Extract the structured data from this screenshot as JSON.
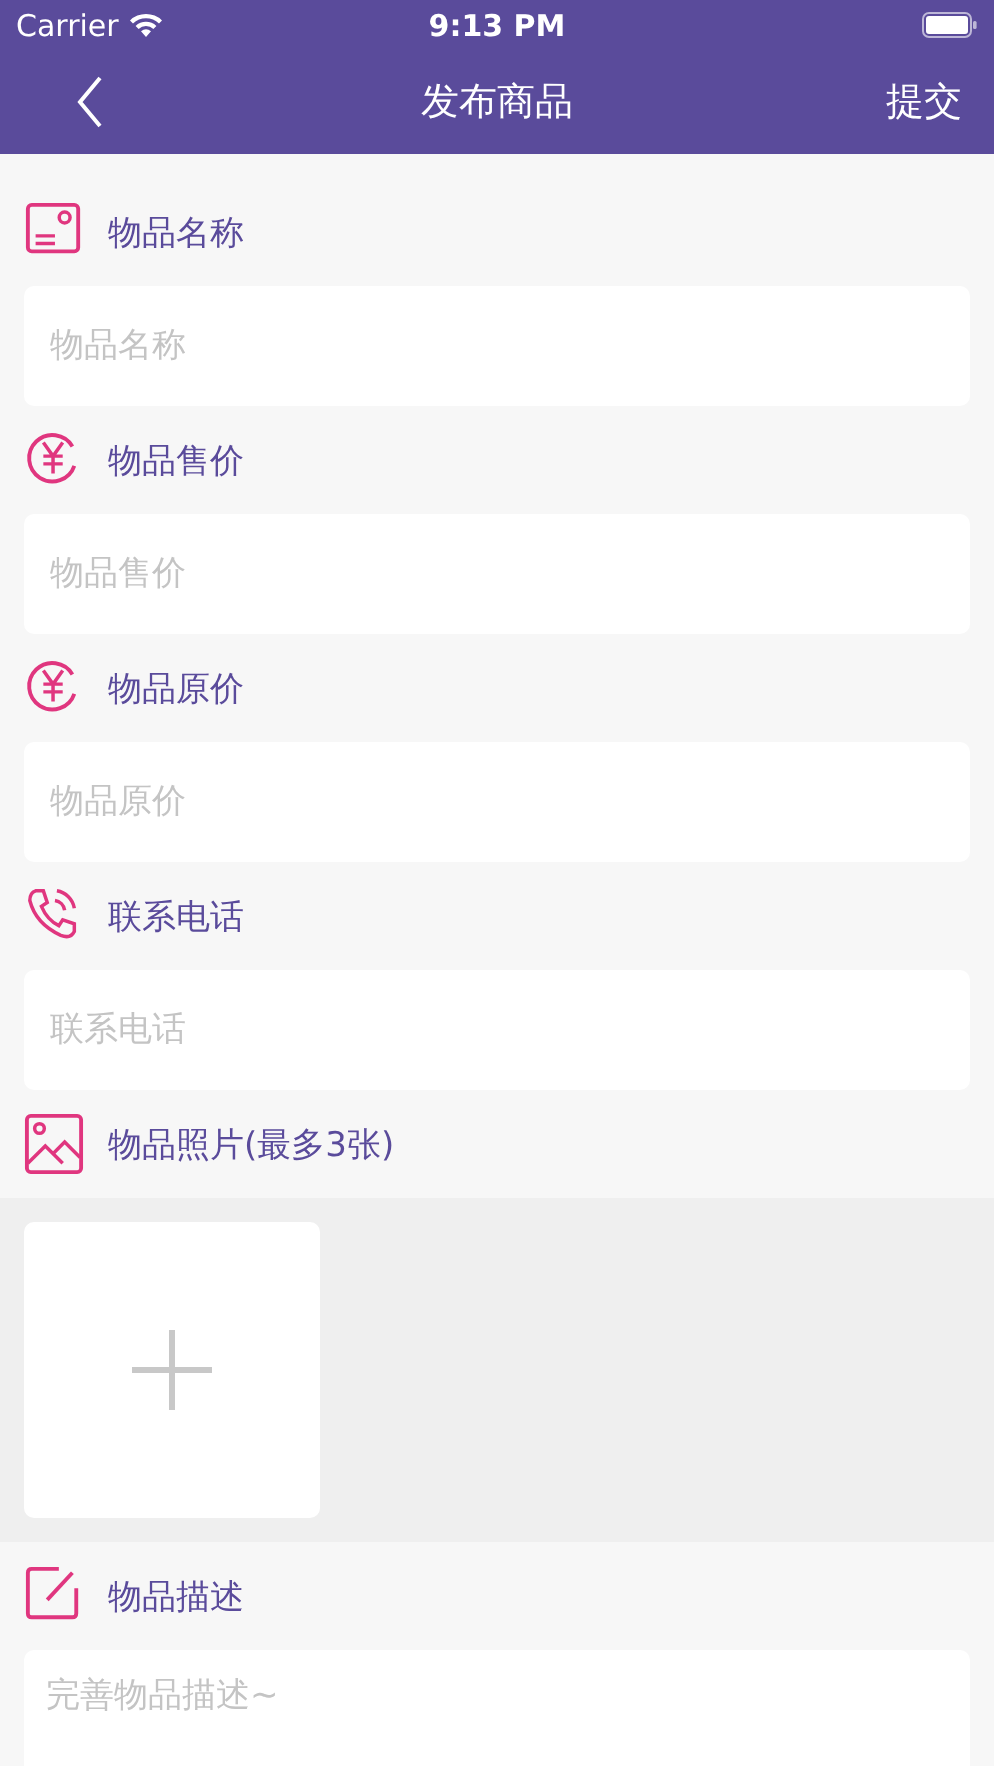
{
  "status_bar": {
    "carrier": "Carrier",
    "time": "9:13 PM"
  },
  "nav": {
    "title": "发布商品",
    "action": "提交"
  },
  "sections": [
    {
      "kind": "input",
      "label": "物品名称",
      "placeholder": "物品名称"
    },
    {
      "kind": "input",
      "label": "物品售价",
      "placeholder": "物品售价"
    },
    {
      "kind": "input",
      "label": "物品原价",
      "placeholder": "物品原价"
    },
    {
      "kind": "input",
      "label": "联系电话",
      "placeholder": "联系电话"
    },
    {
      "kind": "photos",
      "label": "物品照片(最多3张)"
    },
    {
      "kind": "textarea",
      "label": "物品描述",
      "placeholder": "完善物品描述~"
    }
  ]
}
